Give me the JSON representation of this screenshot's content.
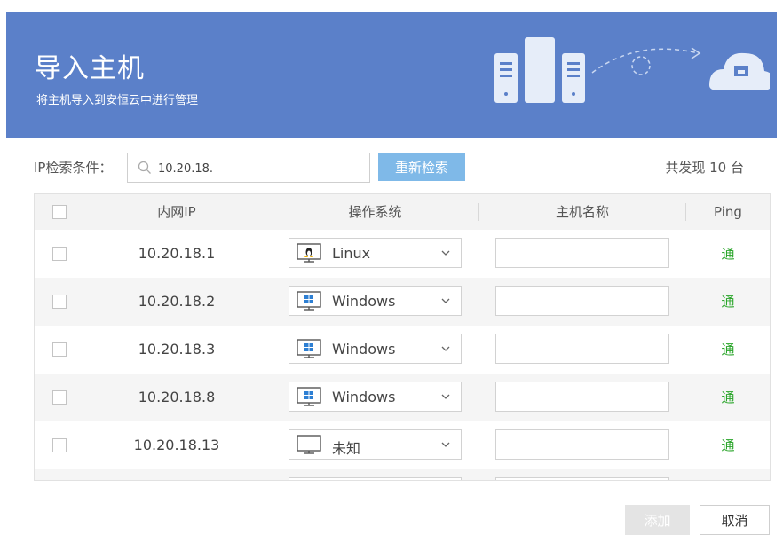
{
  "header": {
    "title": "导入主机",
    "subtitle": "将主机导入到安恒云中进行管理",
    "background_color": "#5b80c9"
  },
  "search": {
    "label": "IP检索条件：",
    "value": "10.20.18.",
    "button_label": "重新检索",
    "found_text": "共发现 10 台"
  },
  "table": {
    "columns": [
      "内网IP",
      "操作系统",
      "主机名称",
      "Ping"
    ],
    "rows": [
      {
        "ip": "10.20.18.1",
        "os": "Linux",
        "os_icon": "linux-icon",
        "hostname": "",
        "ping": "通"
      },
      {
        "ip": "10.20.18.2",
        "os": "Windows",
        "os_icon": "windows-icon",
        "hostname": "",
        "ping": "通"
      },
      {
        "ip": "10.20.18.3",
        "os": "Windows",
        "os_icon": "windows-icon",
        "hostname": "",
        "ping": "通"
      },
      {
        "ip": "10.20.18.8",
        "os": "Windows",
        "os_icon": "windows-icon",
        "hostname": "",
        "ping": "通"
      },
      {
        "ip": "10.20.18.13",
        "os": "未知",
        "os_icon": "monitor-icon",
        "hostname": "",
        "ping": "通"
      }
    ],
    "ping_color": "#2aa52a"
  },
  "footer": {
    "add_label": "添加",
    "cancel_label": "取消"
  }
}
